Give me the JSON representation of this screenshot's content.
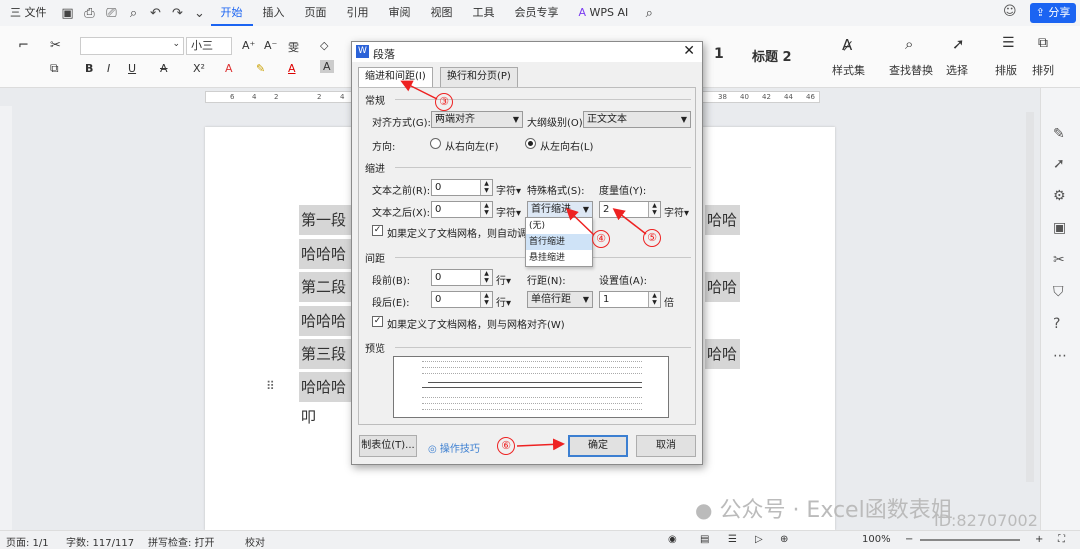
{
  "menubar": {
    "file": "三 文件",
    "tabs": [
      "开始",
      "插入",
      "页面",
      "引用",
      "审阅",
      "视图",
      "工具",
      "会员专享"
    ],
    "active_tab": "开始",
    "wps_ai": "WPS AI",
    "share": "分享"
  },
  "ribbon": {
    "font_size": "小三",
    "heading1": "1",
    "heading2": "标题 2",
    "style_set": "样式集",
    "find_replace": "查找替换",
    "select": "选择",
    "layout": "排版",
    "arrange": "排列"
  },
  "ruler": {
    "ticks_left": [
      "6",
      "4",
      "2",
      "2",
      "4"
    ],
    "ticks_right": [
      "38",
      "40",
      "42",
      "44",
      "46"
    ]
  },
  "document": {
    "lines": [
      "第一段",
      "哈哈哈叩",
      "第二段",
      "哈哈哈叩",
      "第三段",
      "哈哈哈叩"
    ],
    "right_fragments": [
      "哈哈",
      "哈哈",
      "哈哈"
    ]
  },
  "dialog": {
    "title": "段落",
    "tabs": [
      "缩进和间距(I)",
      "换行和分页(P)"
    ],
    "general": {
      "section": "常规",
      "align_label": "对齐方式(G):",
      "align_value": "两端对齐",
      "outline_label": "大纲级别(O):",
      "outline_value": "正文文本",
      "direction_label": "方向:",
      "rtl": "从右向左(F)",
      "ltr": "从左向右(L)"
    },
    "indent": {
      "section": "缩进",
      "before_label": "文本之前(R):",
      "before_value": "0",
      "after_label": "文本之后(X):",
      "after_value": "0",
      "unit": "字符",
      "special_label": "特殊格式(S):",
      "special_value": "首行缩进",
      "measure_label": "度量值(Y):",
      "measure_value": "2",
      "grid_check": "如果定义了文档网格，则自动调整",
      "options": [
        "(无)",
        "首行缩进",
        "悬挂缩进"
      ]
    },
    "spacing": {
      "section": "间距",
      "before_label": "段前(B):",
      "before_value": "0",
      "after_label": "段后(E):",
      "after_value": "0",
      "unit": "行",
      "line_label": "行距(N):",
      "line_value": "单倍行距",
      "set_label": "设置值(A):",
      "set_value": "1",
      "set_unit": "倍",
      "grid_check": "如果定义了文档网格，则与网格对齐(W)"
    },
    "preview": {
      "section": "预览"
    },
    "buttons": {
      "tabs": "制表位(T)...",
      "tips": "操作技巧",
      "ok": "确定",
      "cancel": "取消"
    }
  },
  "callouts": [
    "③",
    "④",
    "⑤",
    "⑥"
  ],
  "status": {
    "page": "页面: 1/1",
    "words": "字数: 117/117",
    "spell": "拼写检查: 打开",
    "proof": "校对",
    "zoom": "100%"
  },
  "watermark": {
    "text": "公众号 · Excel函数表姐",
    "id": "ID:82707002"
  },
  "colors": {
    "accent": "#1b64f2",
    "callout": "#e22222"
  }
}
